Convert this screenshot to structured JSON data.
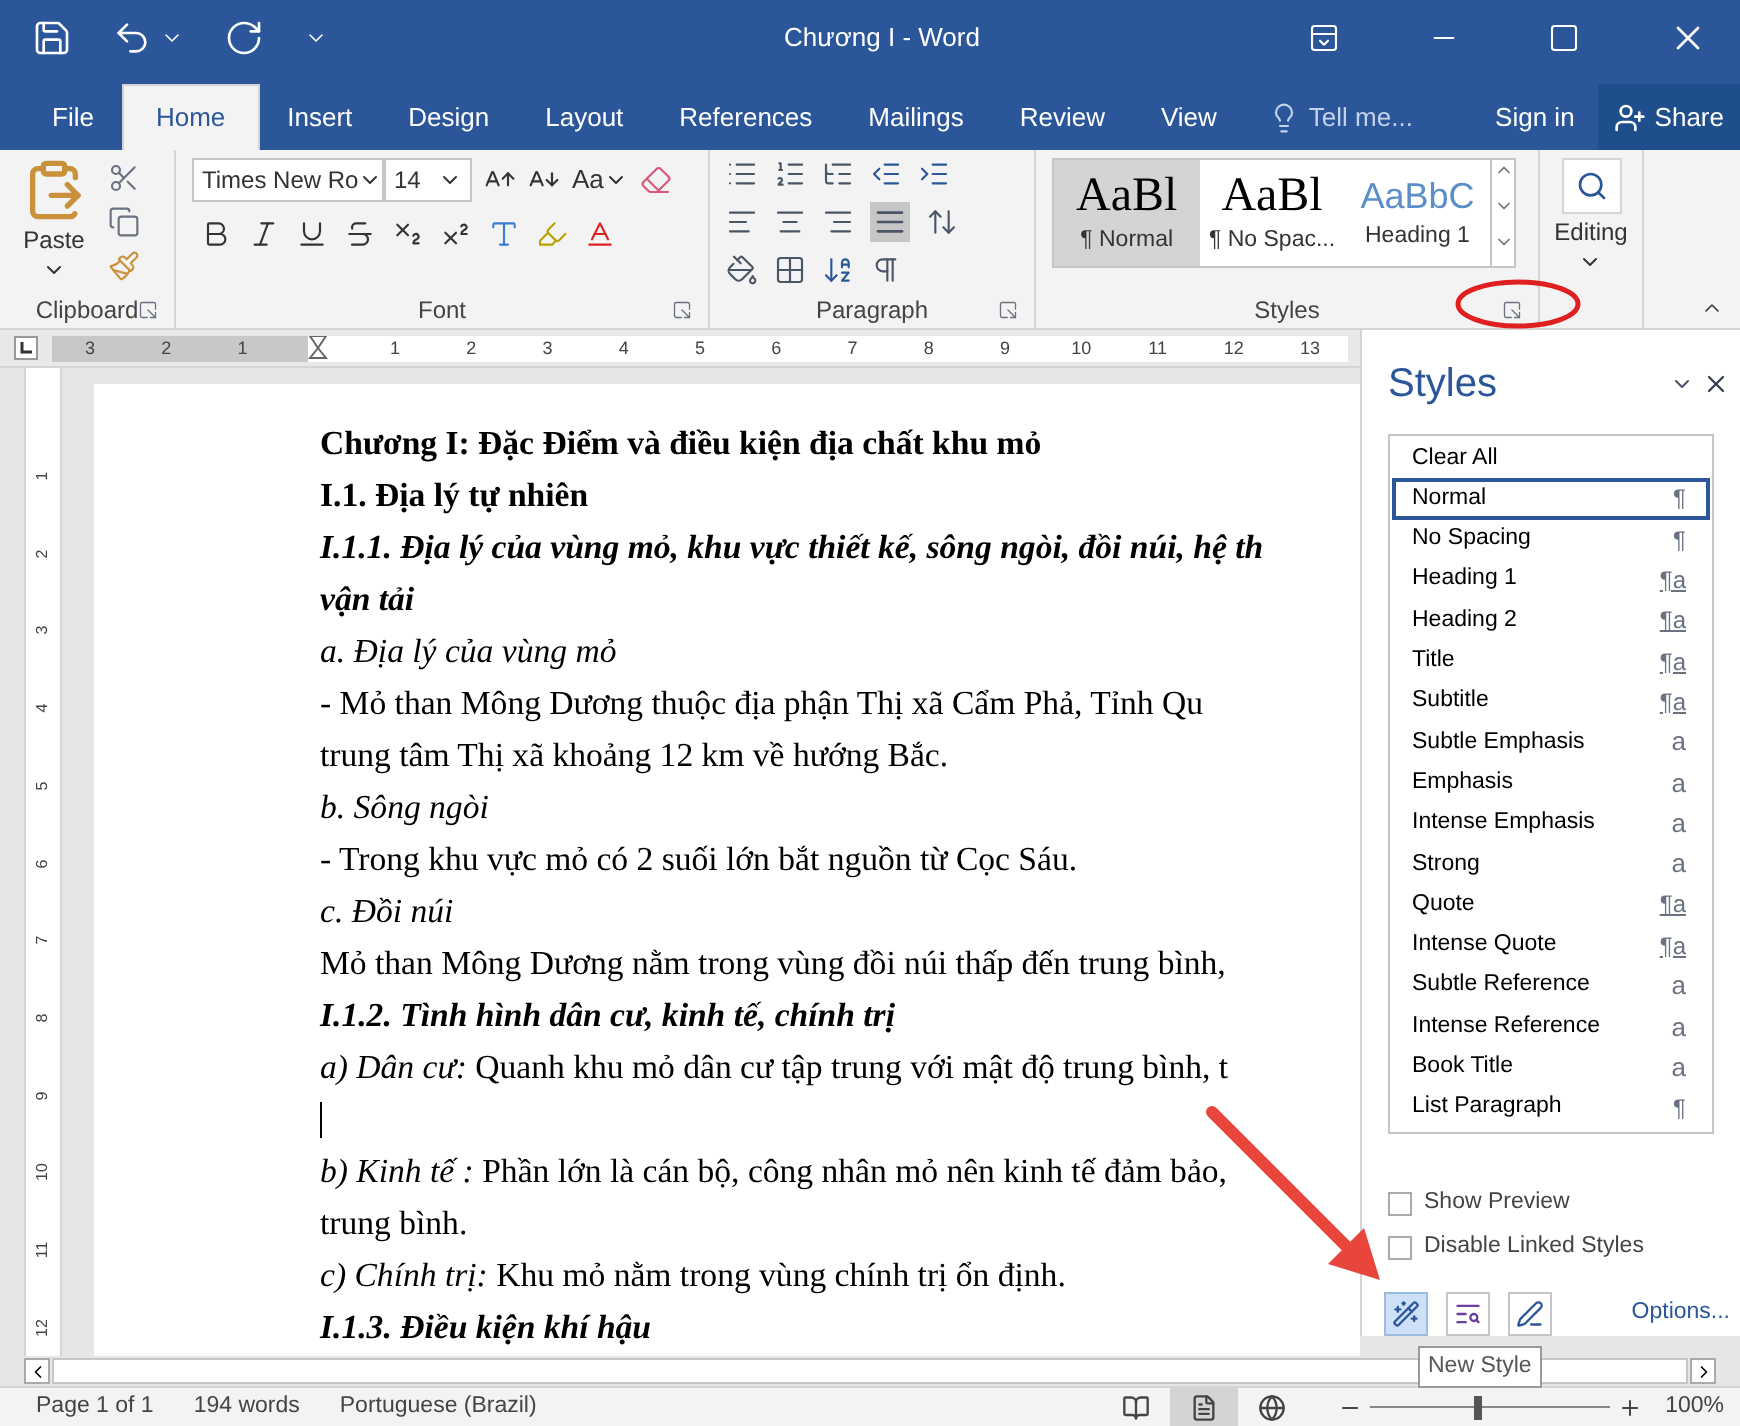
{
  "window": {
    "title": "Chương I - Word",
    "sign_in": "Sign in",
    "share": "Share"
  },
  "tabs": [
    {
      "label": "File",
      "selected": false
    },
    {
      "label": "Home",
      "selected": true
    },
    {
      "label": "Insert",
      "selected": false
    },
    {
      "label": "Design",
      "selected": false
    },
    {
      "label": "Layout",
      "selected": false
    },
    {
      "label": "References",
      "selected": false
    },
    {
      "label": "Mailings",
      "selected": false
    },
    {
      "label": "Review",
      "selected": false
    },
    {
      "label": "View",
      "selected": false
    }
  ],
  "tell_me": "Tell me...",
  "ribbon": {
    "clipboard": {
      "paste": "Paste",
      "label": "Clipboard"
    },
    "font": {
      "font_name": "Times New Ro",
      "font_size": "14",
      "change_case": "Aa",
      "label": "Font"
    },
    "paragraph": {
      "label": "Paragraph"
    },
    "styles": {
      "label": "Styles",
      "gallery": [
        {
          "preview": "AaBl",
          "caption": "¶ Normal",
          "kind": "body",
          "selected": true
        },
        {
          "preview": "AaBl",
          "caption": "¶ No Spac...",
          "kind": "body",
          "selected": false
        },
        {
          "preview": "AaBbC",
          "caption": "Heading 1",
          "kind": "heading",
          "selected": false
        }
      ]
    },
    "editing": {
      "label": "Editing"
    }
  },
  "ruler": {
    "labels": [
      "3",
      "2",
      "1",
      "1",
      "2",
      "3",
      "4",
      "5",
      "6",
      "7",
      "8",
      "9",
      "10",
      "11",
      "12",
      "13"
    ],
    "vertical_labels": [
      "1",
      "2",
      "3",
      "4",
      "5",
      "6",
      "7",
      "8",
      "9",
      "10",
      "11",
      "12"
    ]
  },
  "document": {
    "paragraphs": [
      {
        "kind": "heading",
        "text": "Chương I: Đặc Điểm và điều kiện địa chất khu mỏ"
      },
      {
        "kind": "heading",
        "text": "I.1. Địa lý tự  nhiên"
      },
      {
        "kind": "subheading",
        "text": "I.1.1. Địa lý của vùng mỏ, khu vực thiết kế, sông ngòi, đồi núi, hệ th"
      },
      {
        "kind": "subheading",
        "text": "vận tải"
      },
      {
        "kind": "label",
        "text": "a. Địa lý của vùng mỏ"
      },
      {
        "kind": "body",
        "text": "- Mỏ than Mông Dương thuộc địa phận Thị xã Cẩm Phả, Tỉnh Qu"
      },
      {
        "kind": "body",
        "text": "trung tâm Thị xã khoảng 12 km về hướng Bắc."
      },
      {
        "kind": "label",
        "text": "b. Sông ngòi"
      },
      {
        "kind": "body",
        "text": "- Trong khu vực mỏ có 2 suối lớn bắt nguồn từ Cọc Sáu."
      },
      {
        "kind": "label",
        "text": "c. Đồi núi"
      },
      {
        "kind": "body",
        "text": " Mỏ than Mông Dương nằm trong vùng đồi núi thấp đến trung bình,"
      },
      {
        "kind": "subheading",
        "text": "I.1.2.  Tình hình dân cư, kinh tế, chính trị"
      },
      {
        "kind": "body",
        "text": "*a) Dân cư:*  Quanh khu mỏ dân cư tập trung với mật độ trung bình, t"
      },
      {
        "kind": "cursor"
      },
      {
        "kind": "body",
        "text": "*b) Kinh tế :* Phần lớn là cán bộ, công nhân mỏ nên kinh tế đảm bảo,"
      },
      {
        "kind": "body",
        "text": "trung bình."
      },
      {
        "kind": "body",
        "text": "*c) Chính trị:* Khu mỏ nằm trong vùng chính trị ổn định."
      },
      {
        "kind": "subheading",
        "text": "I.1.3. Điều kiện khí hậu"
      }
    ]
  },
  "styles_pane": {
    "title": "Styles",
    "items": [
      {
        "name": "Clear All",
        "kind": "none",
        "selected": false
      },
      {
        "name": "Normal",
        "kind": "paragraph",
        "mark": "¶",
        "selected": true
      },
      {
        "name": "No Spacing",
        "kind": "paragraph",
        "mark": "¶",
        "selected": false
      },
      {
        "name": "Heading 1",
        "kind": "linked",
        "mark": "¶a",
        "selected": false
      },
      {
        "name": "Heading 2",
        "kind": "linked",
        "mark": "¶a",
        "selected": false
      },
      {
        "name": "Title",
        "kind": "linked",
        "mark": "¶a",
        "selected": false
      },
      {
        "name": "Subtitle",
        "kind": "linked",
        "mark": "¶a",
        "selected": false
      },
      {
        "name": "Subtle Emphasis",
        "kind": "character",
        "mark": "a",
        "selected": false
      },
      {
        "name": "Emphasis",
        "kind": "character",
        "mark": "a",
        "selected": false
      },
      {
        "name": "Intense Emphasis",
        "kind": "character",
        "mark": "a",
        "selected": false
      },
      {
        "name": "Strong",
        "kind": "character",
        "mark": "a",
        "selected": false
      },
      {
        "name": "Quote",
        "kind": "linked",
        "mark": "¶a",
        "selected": false
      },
      {
        "name": "Intense Quote",
        "kind": "linked",
        "mark": "¶a",
        "selected": false
      },
      {
        "name": "Subtle Reference",
        "kind": "character",
        "mark": "a",
        "selected": false
      },
      {
        "name": "Intense Reference",
        "kind": "character",
        "mark": "a",
        "selected": false
      },
      {
        "name": "Book Title",
        "kind": "character",
        "mark": "a",
        "selected": false
      },
      {
        "name": "List Paragraph",
        "kind": "paragraph",
        "mark": "¶",
        "selected": false
      }
    ],
    "options": [
      {
        "label": "Show Preview",
        "checked": false
      },
      {
        "label": "Disable Linked Styles",
        "checked": false
      }
    ],
    "link": "Options...",
    "tooltip": "New Style"
  },
  "status_bar": {
    "page": "Page 1 of 1",
    "words": "194 words",
    "language": "Portuguese (Brazil)",
    "views": [
      {
        "kind": "read",
        "selected": false
      },
      {
        "kind": "print",
        "selected": true
      },
      {
        "kind": "web",
        "selected": false
      }
    ],
    "zoom": {
      "level": 0.45,
      "reading": "100%"
    }
  }
}
